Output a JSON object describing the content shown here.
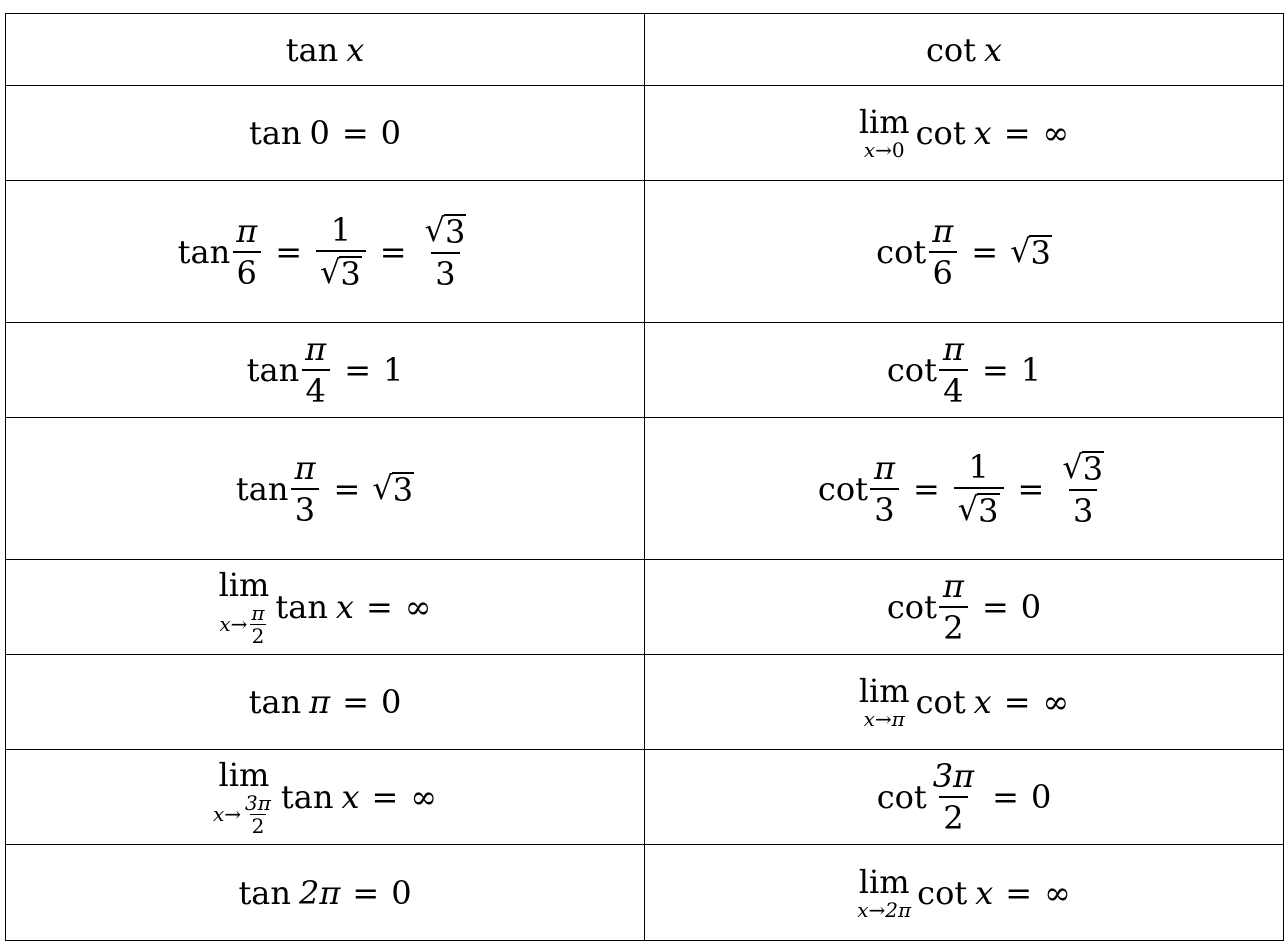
{
  "headers": {
    "left_fn": "tan",
    "left_var": "x",
    "right_fn": "cot",
    "right_var": "x"
  },
  "sym": {
    "eq": "=",
    "inf": "∞",
    "pi": "π",
    "sqrt": "√",
    "arrow": "→",
    "lim": "lim",
    "tan": "tan",
    "cot": "cot",
    "x": "x"
  },
  "rows": [
    {
      "left": {
        "arg": "0",
        "val": "0"
      },
      "right": {
        "approach": "0"
      }
    },
    {
      "left": {
        "num": "π",
        "den": "6",
        "f_num": "1",
        "f_den_sqrt": "3",
        "r_num_sqrt": "3",
        "r_den": "3"
      },
      "right": {
        "num": "π",
        "den": "6",
        "sqrt": "3"
      }
    },
    {
      "left": {
        "num": "π",
        "den": "4",
        "val": "1"
      },
      "right": {
        "num": "π",
        "den": "4",
        "val": "1"
      }
    },
    {
      "left": {
        "num": "π",
        "den": "3",
        "sqrt": "3"
      },
      "right": {
        "num": "π",
        "den": "3",
        "f_num": "1",
        "f_den_sqrt": "3",
        "r_num_sqrt": "3",
        "r_den": "3"
      }
    },
    {
      "left": {
        "approach_num": "π",
        "approach_den": "2"
      },
      "right": {
        "num": "π",
        "den": "2",
        "val": "0"
      }
    },
    {
      "left": {
        "arg": "π",
        "val": "0"
      },
      "right": {
        "approach": "π"
      }
    },
    {
      "left": {
        "approach_num": "3π",
        "approach_den": "2"
      },
      "right": {
        "num": "3π",
        "den": "2",
        "val": "0"
      }
    },
    {
      "left": {
        "arg": "2π",
        "val": "0"
      },
      "right": {
        "approach": "2π"
      }
    }
  ]
}
